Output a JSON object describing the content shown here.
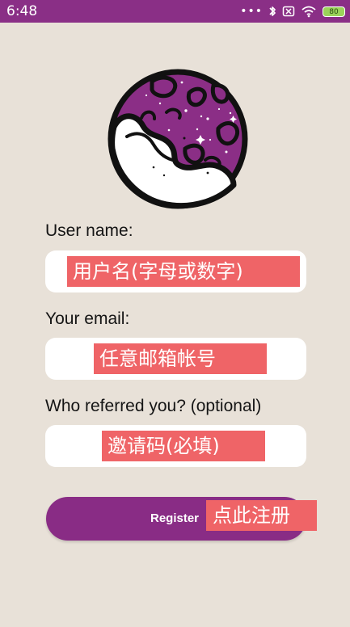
{
  "status_bar": {
    "time": "6:48",
    "dots": "•••",
    "battery": "80",
    "icons": [
      "bluetooth-icon",
      "sim-icon",
      "wifi-icon",
      "battery-icon"
    ]
  },
  "logo": {
    "icon": "planet-logo-icon"
  },
  "form": {
    "username": {
      "label": "User name:",
      "hint": "用户名(字母或数字)"
    },
    "email": {
      "label": "Your email:",
      "hint": "任意邮箱帐号"
    },
    "referrer": {
      "label": "Who referred you? (optional)",
      "hint": "邀请码(必填)"
    },
    "register": {
      "label": "Register",
      "hint": "点此注册"
    }
  },
  "colors": {
    "primary": "#8a2f86",
    "background": "#e8e1d8",
    "annotation": "#ef6467"
  }
}
